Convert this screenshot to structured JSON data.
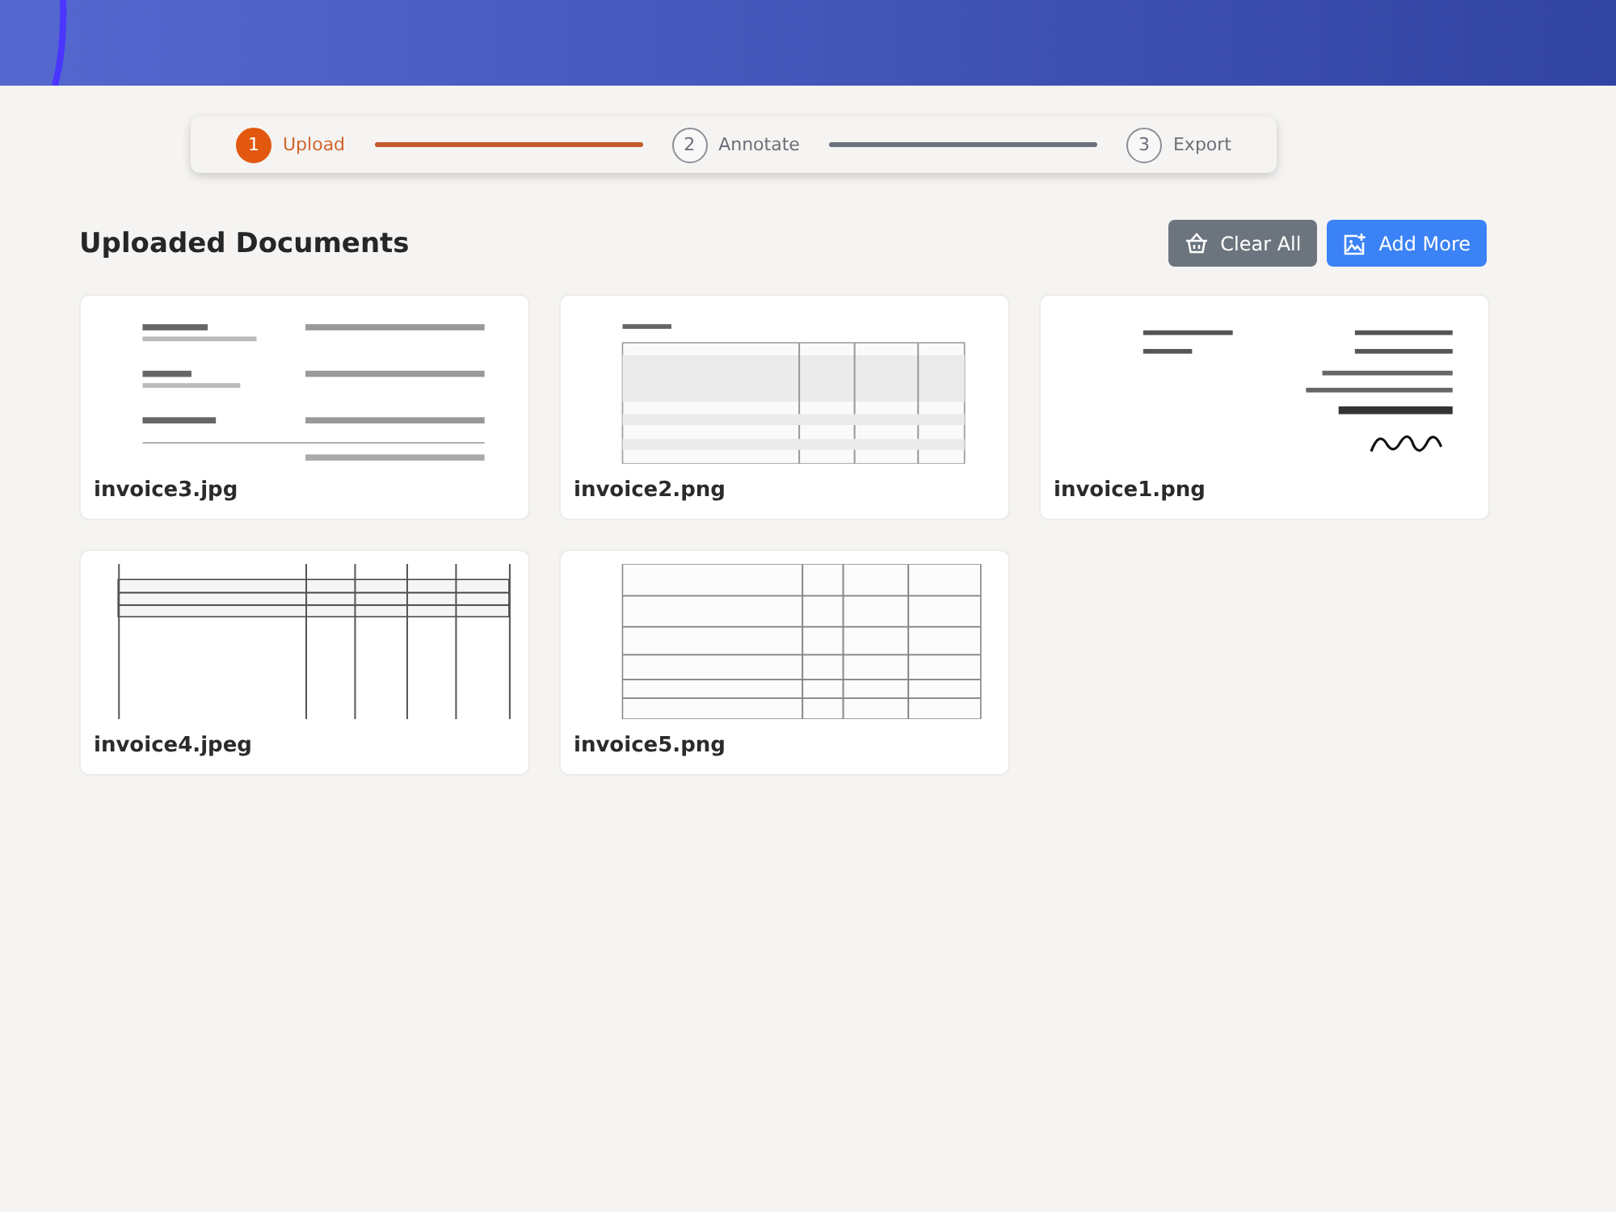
{
  "steps": [
    {
      "number": "1",
      "label": "Upload",
      "selected": true
    },
    {
      "number": "2",
      "label": "Annotate",
      "selected": false
    },
    {
      "number": "3",
      "label": "Export",
      "selected": false
    }
  ],
  "title": "Uploaded Documents",
  "buttons": [
    {
      "kind": "clear",
      "label": "Clear All"
    },
    {
      "kind": "add",
      "label": "Add More"
    }
  ],
  "documents": [
    {
      "name": "invoice3.jpg",
      "kind": "picture"
    },
    {
      "name": "invoice2.png",
      "kind": "picture"
    },
    {
      "name": "invoice1.png",
      "kind": "picture"
    },
    {
      "name": "invoice4.jpeg",
      "kind": "picture"
    },
    {
      "name": "invoice5.png",
      "kind": "picture"
    }
  ]
}
